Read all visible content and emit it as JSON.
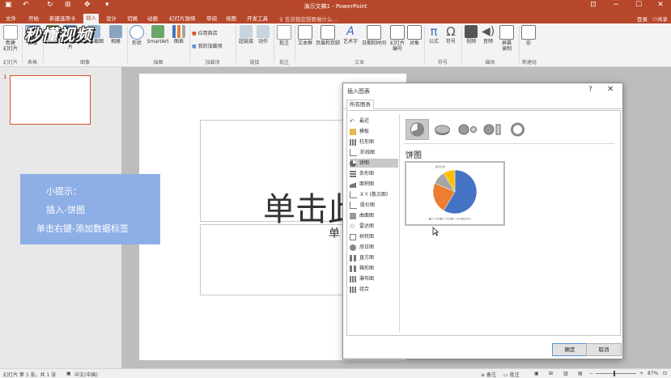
{
  "window": {
    "title": "演示文稿1 - PowerPoint",
    "accent_color": "#b7472a"
  },
  "tabs": [
    "文件",
    "开始",
    "新建选项卡",
    "插入",
    "设计",
    "切换",
    "动画",
    "幻灯片放映",
    "审阅",
    "视图",
    "开发工具"
  ],
  "active_tab": "插入",
  "tell_me": "告诉我您想要做什么...",
  "account": {
    "login": "登录",
    "share": "共享"
  },
  "ribbon": {
    "buttons": [
      {
        "label": "新建\n幻灯片",
        "icon": "new-slide-icon"
      },
      {
        "label": "表格",
        "icon": "table-icon"
      },
      {
        "label": "图片",
        "icon": "picture-icon"
      },
      {
        "label": "联机图片",
        "icon": "online-picture-icon"
      },
      {
        "label": "屏幕截图",
        "icon": "screenshot-icon"
      },
      {
        "label": "相册",
        "icon": "album-icon"
      },
      {
        "label": "形状",
        "icon": "shapes-icon"
      },
      {
        "label": "SmartArt",
        "icon": "smartart-icon"
      },
      {
        "label": "图表",
        "icon": "chart-icon"
      },
      {
        "label": "超链接",
        "icon": "hyperlink-icon"
      },
      {
        "label": "动作",
        "icon": "action-icon"
      },
      {
        "label": "批注",
        "icon": "comment-icon"
      },
      {
        "label": "文本框",
        "icon": "textbox-icon"
      },
      {
        "label": "页眉和页脚",
        "icon": "header-footer-icon"
      },
      {
        "label": "艺术字",
        "icon": "wordart-icon"
      },
      {
        "label": "日期和时间",
        "icon": "datetime-icon"
      },
      {
        "label": "幻灯片\n编号",
        "icon": "slide-number-icon"
      },
      {
        "label": "对象",
        "icon": "object-icon"
      },
      {
        "label": "公式",
        "icon": "equation-icon"
      },
      {
        "label": "符号",
        "icon": "symbol-icon"
      },
      {
        "label": "视频",
        "icon": "video-icon"
      },
      {
        "label": "音频",
        "icon": "audio-icon"
      },
      {
        "label": "屏幕\n录制",
        "icon": "screen-record-icon"
      },
      {
        "label": "宏",
        "icon": "macro-icon"
      }
    ],
    "addins": {
      "store": "应用商店",
      "my_addins": "我的加载项"
    },
    "groups": [
      "幻灯片",
      "表格",
      "图像",
      "插图",
      "加载项",
      "链接",
      "批注",
      "文本",
      "符号",
      "媒体",
      "新建组"
    ]
  },
  "logo_text": "秒懂视频",
  "slide_panel": {
    "number": "1"
  },
  "slide": {
    "title_placeholder": "单击此",
    "subtitle_placeholder": "单"
  },
  "tip": {
    "line1": "小提示：",
    "line2": "插入-饼图",
    "line3": "单击右键-添加数据标签"
  },
  "dialog": {
    "title": "插入图表",
    "help": "?",
    "close": "✕",
    "tab": "所有图表",
    "chart_types": [
      "最近",
      "模板",
      "柱形图",
      "折线图",
      "饼图",
      "条形图",
      "面积图",
      "X Y (散点图)",
      "股价图",
      "曲面图",
      "雷达图",
      "树状图",
      "旭日图",
      "直方图",
      "箱形图",
      "瀑布图",
      "组合"
    ],
    "selected_type": "饼图",
    "subtype_heading": "饼图",
    "subtypes": [
      "pie-icon",
      "3d-pie-icon",
      "pie-of-pie-icon",
      "bar-of-pie-icon",
      "doughnut-icon"
    ],
    "preview_title": "图表标题",
    "preview_legend": "■第一季度 ■第二季度 ■第三季度 ■第四季度",
    "preview_slices": [
      8.2,
      3.2,
      1.4,
      1.2
    ],
    "slice_colors": [
      "#4472c4",
      "#ed7d31",
      "#a5a5a5",
      "#ffc000"
    ],
    "ok": "确定",
    "cancel": "取消"
  },
  "status": {
    "slide_info": "幻灯片 第 1 张，共 1 张",
    "language": "中文(中国)",
    "notes": "备注",
    "comments": "批注",
    "zoom": "87%"
  }
}
